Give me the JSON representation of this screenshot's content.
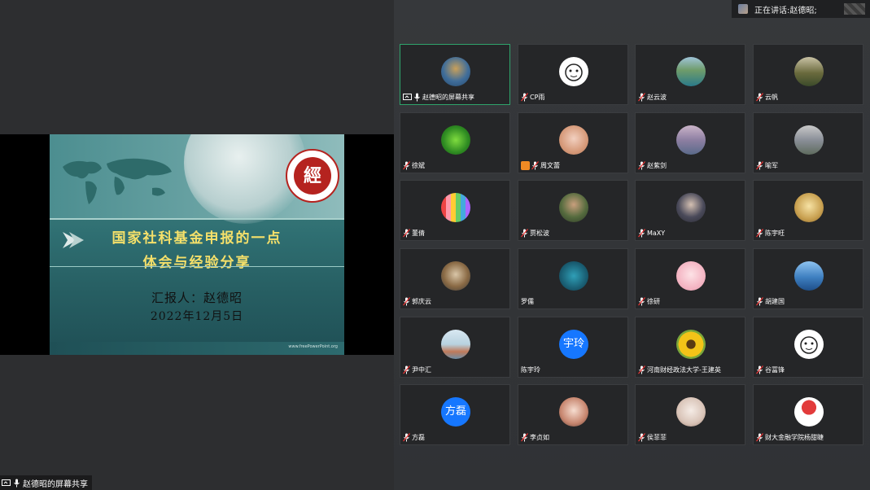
{
  "share_label": "赵德昭的屏幕共享",
  "speaking": {
    "prefix": "正在讲话: ",
    "name": "赵德昭;"
  },
  "slide": {
    "seal_text": "經",
    "title_line1": "国家社科基金申报的一点",
    "title_line2": "体会与经验分享",
    "reporter": "汇报人：赵德昭",
    "date": "2022年12月5日",
    "site": "www.freePowerPoint.org"
  },
  "participants": [
    {
      "name": "赵德昭的屏幕共享",
      "avatar": "photo-lake",
      "share": true,
      "active": true
    },
    {
      "name": "CP雨",
      "avatar": "cartoon-face"
    },
    {
      "name": "赵云波",
      "avatar": "photo-mountain-lake"
    },
    {
      "name": "云帆",
      "avatar": "photo-forest"
    },
    {
      "name": "徐斌",
      "avatar": "photo-leaf"
    },
    {
      "name": "周文蕾",
      "avatar": "photo-cartoon-deer",
      "user_badge": true
    },
    {
      "name": "赵紫剑",
      "avatar": "photo-person"
    },
    {
      "name": "喻军",
      "avatar": "photo-river"
    },
    {
      "name": "董倩",
      "avatar": "photo-rainbow"
    },
    {
      "name": "贾松波",
      "avatar": "photo-people"
    },
    {
      "name": "MaXY",
      "avatar": "photo-woman"
    },
    {
      "name": "陈宇旺",
      "avatar": "photo-golden"
    },
    {
      "name": "郭庆云",
      "avatar": "photo-dog"
    },
    {
      "name": "罗儒",
      "avatar": "photo-ocean",
      "no_mic": true
    },
    {
      "name": "徐研",
      "avatar": "photo-baby"
    },
    {
      "name": "胡建国",
      "avatar": "photo-sky-sea"
    },
    {
      "name": "尹中汇",
      "avatar": "photo-beach"
    },
    {
      "name": "陈宇玲",
      "avatar": "text",
      "avatar_text": "宇玲",
      "no_mic": true
    },
    {
      "name": "河南财经政法大学-王建英",
      "avatar": "photo-sunflower"
    },
    {
      "name": "谷冨锋",
      "avatar": "cartoon-cow"
    },
    {
      "name": "方磊",
      "avatar": "text",
      "avatar_text": "方磊"
    },
    {
      "name": "李贞如",
      "avatar": "photo-child"
    },
    {
      "name": "侯菲菲",
      "avatar": "photo-girl"
    },
    {
      "name": "财大金融学院杨甜睫",
      "avatar": "cartoon-umbrella"
    }
  ]
}
